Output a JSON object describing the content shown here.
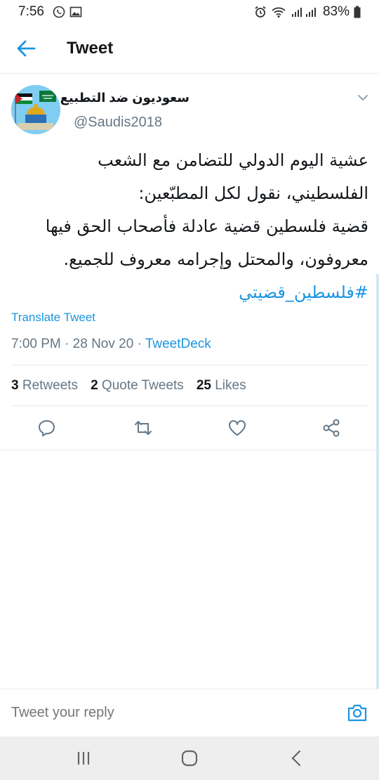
{
  "status_bar": {
    "time": "7:56",
    "battery": "83%"
  },
  "header": {
    "title": "Tweet"
  },
  "tweet": {
    "author_name": "سعوديون ضد التطبيع",
    "author_handle": "@Saudis2018",
    "text_lines": [
      "عشية اليوم الدولي للتضامن مع الشعب",
      "الفلسطيني، نقول لكل المطبّعين:",
      "قضية فلسطين قضية عادلة فأصحاب الحق فيها",
      "معروفون، والمحتل وإجرامه معروف للجميع."
    ],
    "hashtag": "#فلسطين_قضيتي",
    "translate_label": "Translate Tweet",
    "time": "7:00 PM",
    "date": "28 Nov 20",
    "source": "TweetDeck"
  },
  "stats": {
    "retweets_count": "3",
    "retweets_label": "Retweets",
    "quote_count": "2",
    "quote_label": "Quote Tweets",
    "likes_count": "25",
    "likes_label": "Likes"
  },
  "reply": {
    "placeholder": "Tweet your reply"
  },
  "colors": {
    "accent": "#1b95e0",
    "secondary_text": "#657786",
    "divider": "#e6ecf0"
  }
}
